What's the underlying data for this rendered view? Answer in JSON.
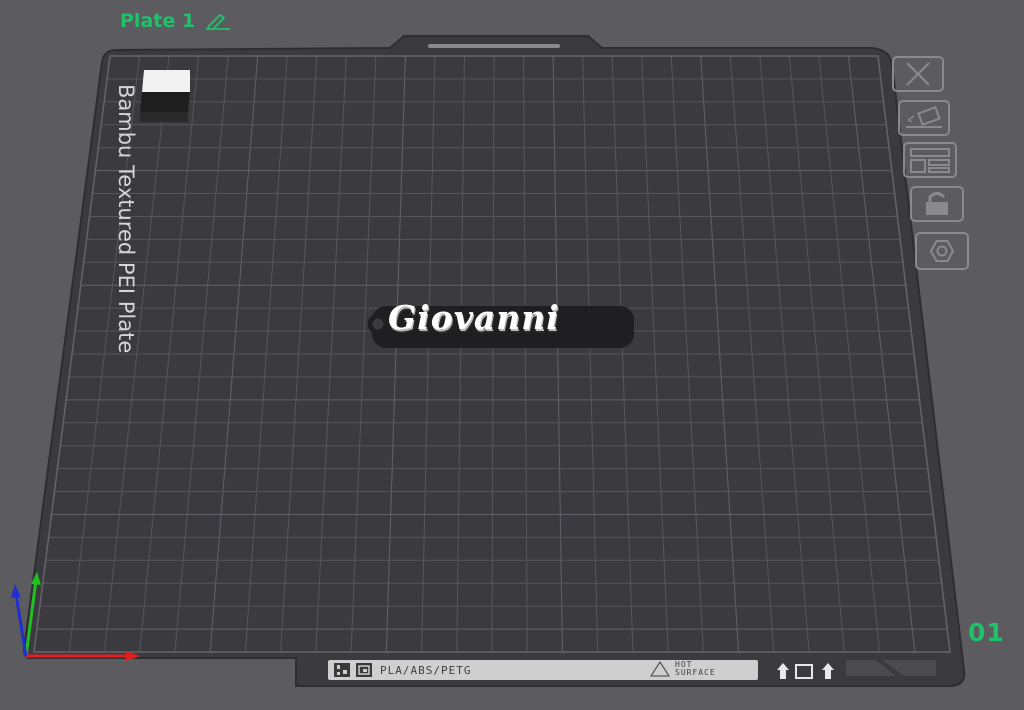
{
  "plate": {
    "title": "Plate 1",
    "number": "01",
    "bed_label": "Bambu Textured PEI Plate"
  },
  "object": {
    "name": "Giovanni"
  },
  "bed_strip": {
    "material": "PLA/ABS/PETG",
    "hot_line1": "HOT",
    "hot_line2": "SURFACE"
  },
  "colors": {
    "accent": "#1fc16b",
    "bed": "#3b3b3f",
    "grid": "#55555a",
    "axis_x": "#e02020",
    "axis_y": "#20c020",
    "axis_z": "#2030d0"
  },
  "tools": [
    {
      "name": "close-plate",
      "icon": "close-icon"
    },
    {
      "name": "auto-orient",
      "icon": "auto-orient-icon"
    },
    {
      "name": "arrange",
      "icon": "arrange-icon"
    },
    {
      "name": "lock-plate",
      "icon": "lock-icon"
    },
    {
      "name": "plate-settings",
      "icon": "hexagon-settings-icon"
    }
  ]
}
